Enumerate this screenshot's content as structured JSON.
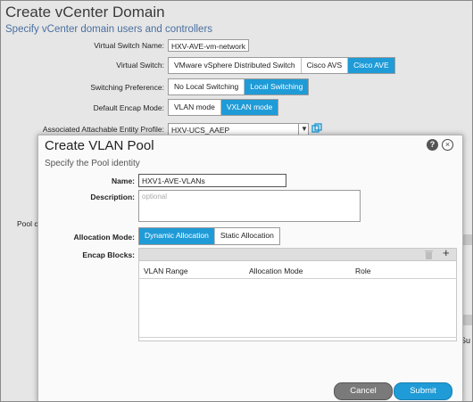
{
  "background": {
    "title": "Create vCenter Domain",
    "subtitle": "Specify vCenter domain users and controllers",
    "vswitch_name_label": "Virtual Switch Name:",
    "vswitch_name_value": "HXV-AVE-vm-network",
    "vswitch_label": "Virtual Switch:",
    "vswitch_options": [
      "VMware vSphere Distributed Switch",
      "Cisco AVS",
      "Cisco AVE"
    ],
    "switching_pref_label": "Switching Preference:",
    "switching_pref_options": [
      "No Local Switching",
      "Local Switching"
    ],
    "encap_label": "Default Encap Mode:",
    "encap_options": [
      "VLAN mode",
      "VXLAN mode"
    ],
    "aaep_label": "Associated Attachable Entity Profile:",
    "aaep_value": "HXV-UCS_AAEP",
    "pool_label_partial": "Pool c",
    "submit_partial": "Su"
  },
  "modal": {
    "title": "Create VLAN Pool",
    "subtitle": "Specify the Pool identity",
    "name_label": "Name:",
    "name_value": "HXV1-AVE-VLANs",
    "description_label": "Description:",
    "description_placeholder": "optional",
    "alloc_label": "Allocation Mode:",
    "alloc_options": [
      "Dynamic Allocation",
      "Static Allocation"
    ],
    "encap_blocks_label": "Encap Blocks:",
    "columns": [
      "VLAN Range",
      "Allocation Mode",
      "Role"
    ],
    "help_icon": "?",
    "close_icon": "×",
    "cancel_label": "Cancel",
    "submit_label": "Submit"
  },
  "colors": {
    "accent": "#1f9bd7",
    "cancel": "#7a7a7a"
  }
}
